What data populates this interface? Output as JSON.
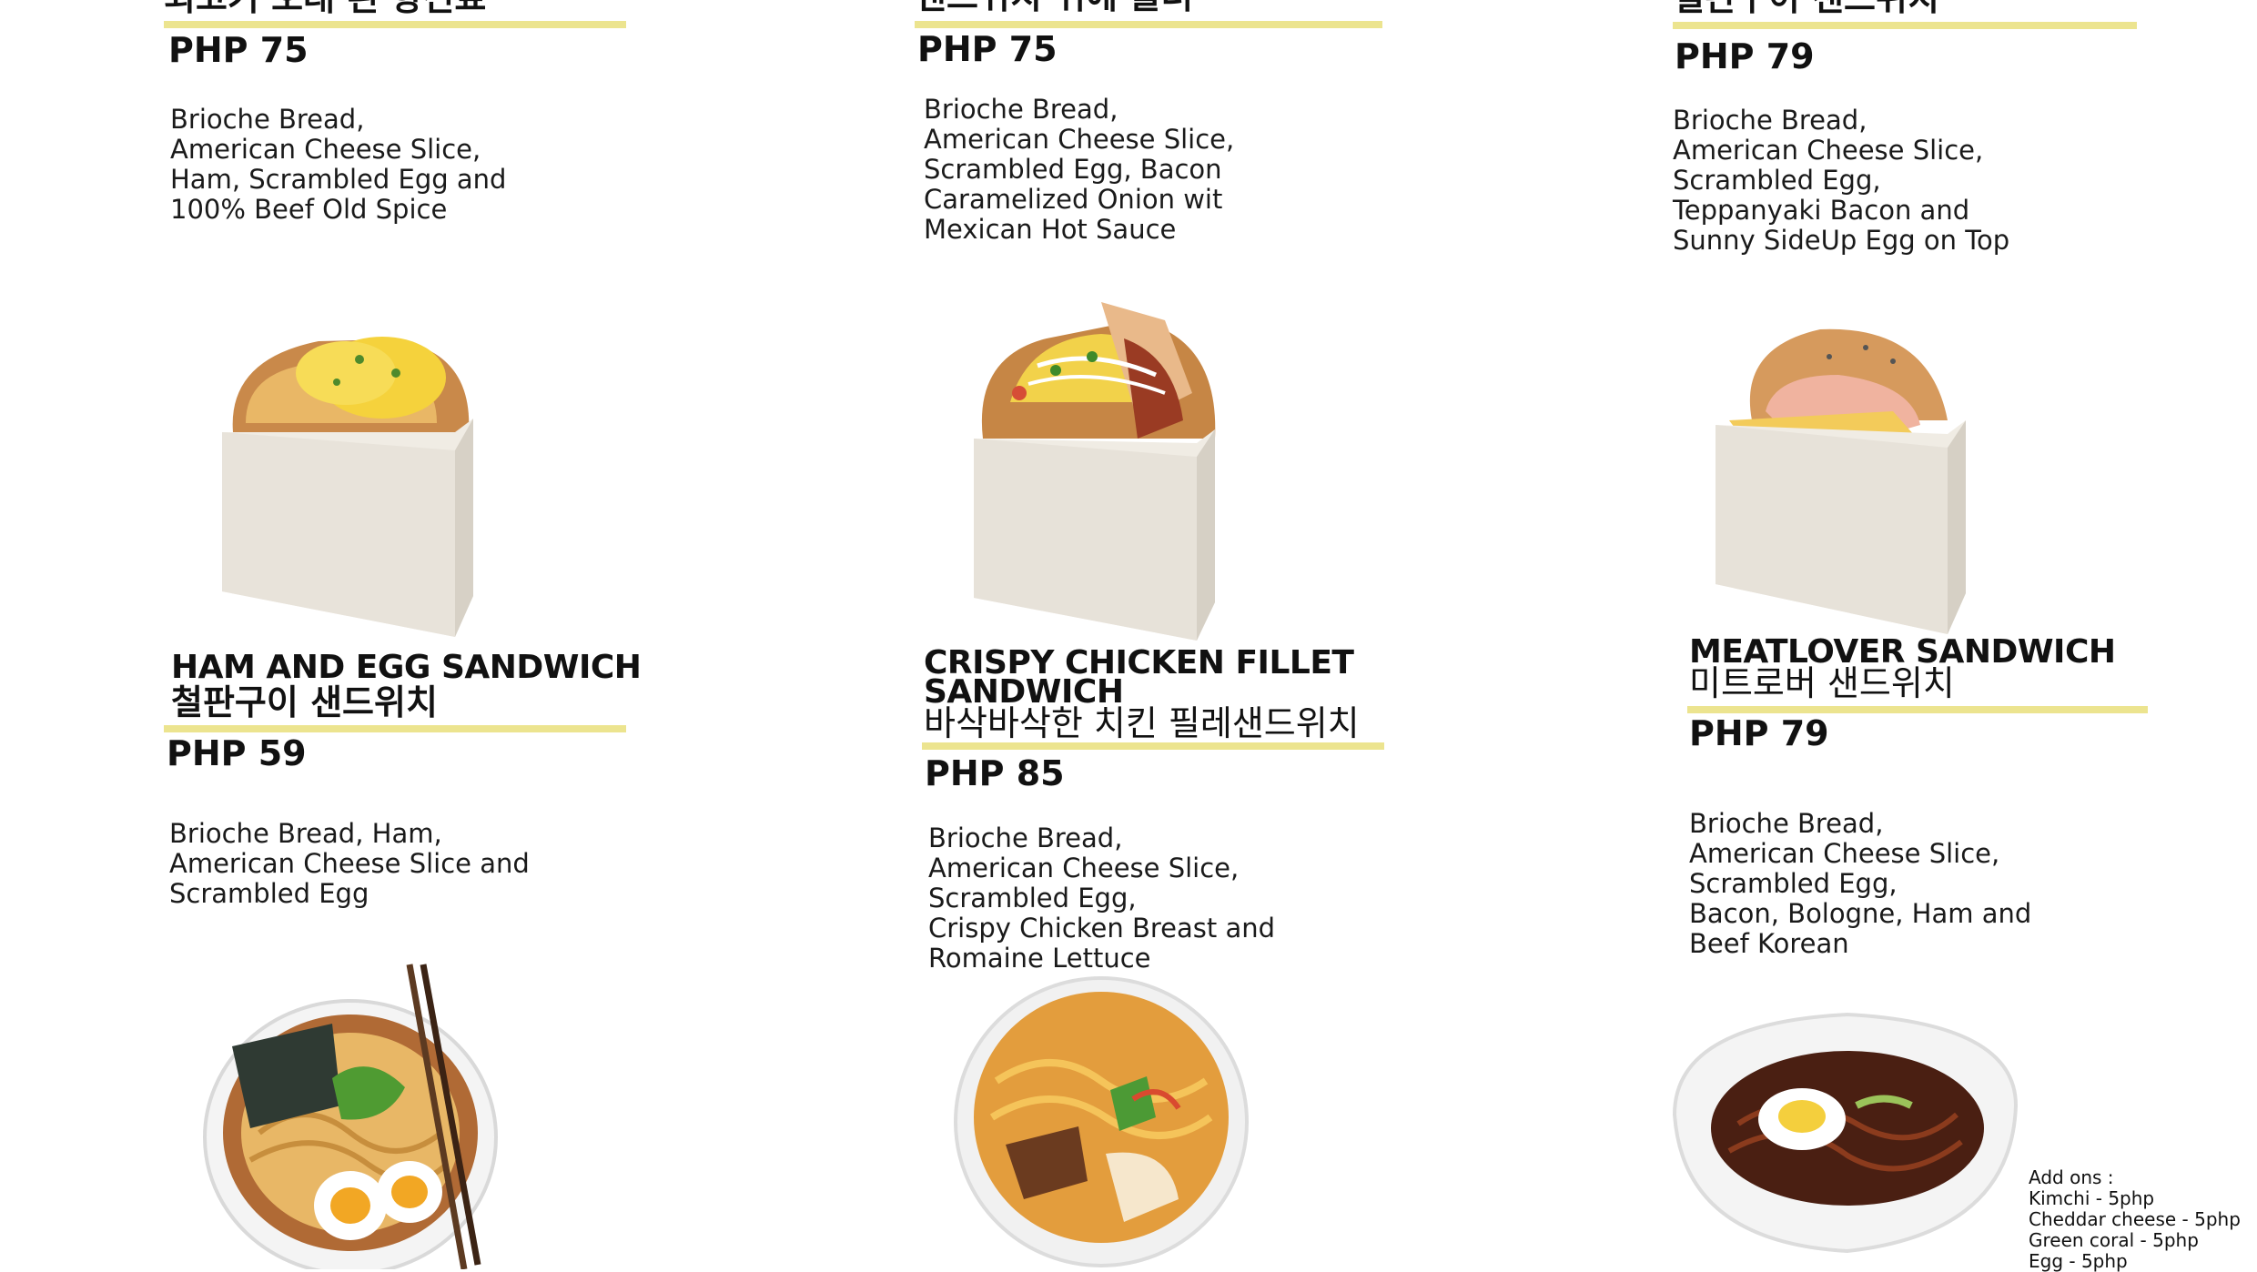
{
  "colors": {
    "accent_rule": "#ece48f",
    "text": "#111111",
    "background": "#ffffff"
  },
  "menu": {
    "top_row": [
      {
        "korean": "쇠고기 오래 된 향신료",
        "price": "PHP 75",
        "description": [
          "Brioche Bread,",
          "American Cheese Slice,",
          "Ham, Scrambled Egg and",
          "100% Beef Old Spice"
        ]
      },
      {
        "korean": "샌드위치 위에 불러",
        "price": "PHP 75",
        "description": [
          "Brioche Bread,",
          "American Cheese Slice,",
          "Scrambled Egg, Bacon",
          "Caramelized Onion wit",
          "Mexican Hot Sauce"
        ]
      },
      {
        "korean": "철판구이 샌드위치",
        "price": "PHP 79",
        "description": [
          "Brioche Bread,",
          "American Cheese Slice,",
          "Scrambled Egg,",
          "Teppanyaki Bacon and",
          "Sunny SideUp Egg on Top"
        ]
      }
    ],
    "bottom_row": [
      {
        "title": "HAM AND EGG SANDWICH",
        "korean": "철판구이 샌드위치",
        "price": "PHP 59",
        "description": [
          "Brioche Bread, Ham,",
          "American Cheese Slice and",
          "Scrambled Egg"
        ]
      },
      {
        "title_line1": "CRISPY CHICKEN FILLET",
        "title_line2": "SANDWICH",
        "korean": "바삭바삭한 치킨 필레샌드위치",
        "price": "PHP 85",
        "description": [
          "Brioche Bread,",
          "American Cheese Slice,",
          "Scrambled Egg,",
          "Crispy Chicken Breast and",
          "Romaine Lettuce"
        ]
      },
      {
        "title": "MEATLOVER SANDWICH",
        "korean": "미트로버 샌드위치",
        "price": "PHP 79",
        "description": [
          "Brioche Bread,",
          "American Cheese Slice,",
          "Scrambled Egg,",
          "Bacon, Bologne, Ham and",
          "Beef Korean"
        ]
      }
    ],
    "addons": {
      "heading": "Add ons  :",
      "items": [
        "Kimchi - 5php",
        "Cheddar cheese - 5php",
        "Green coral - 5php",
        "Egg - 5php"
      ]
    }
  },
  "images": [
    "ham-egg-sandwich-photo",
    "bacon-sandwich-photo",
    "ham-cheese-sandwich-photo",
    "ramen-bowl-photo",
    "kimchi-ramen-bowl-photo",
    "jjajang-noodle-bowl-photo",
    "chopsticks-icon"
  ]
}
